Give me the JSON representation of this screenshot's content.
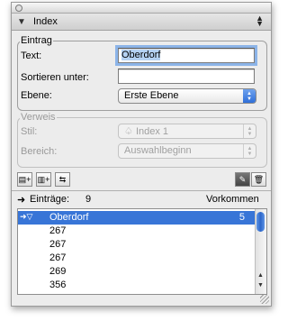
{
  "palette": {
    "title": "Index"
  },
  "entry": {
    "group_label": "Eintrag",
    "text_label": "Text:",
    "text_value": "Oberdorf",
    "sort_label": "Sortieren unter:",
    "sort_value": "",
    "level_label": "Ebene:",
    "level_value": "Erste Ebene"
  },
  "reference": {
    "group_label": "Verweis",
    "style_label": "Stil:",
    "style_value": "Index 1",
    "range_label": "Bereich:",
    "range_value": "Auswahlbeginn"
  },
  "toolbar": {
    "icons": [
      "add-entry-icon",
      "add-reference-icon",
      "find-entry-icon",
      "edit-pencil-icon",
      "trash-icon"
    ]
  },
  "list": {
    "entries_label": "Einträge:",
    "entries_count": "9",
    "occurrences_label": "Vorkommen",
    "rows": [
      {
        "text": "Oberdorf",
        "count": "5",
        "selected": true
      },
      {
        "text": "267",
        "count": ""
      },
      {
        "text": "267",
        "count": ""
      },
      {
        "text": "267",
        "count": ""
      },
      {
        "text": "269",
        "count": ""
      },
      {
        "text": "356",
        "count": ""
      }
    ]
  },
  "colors": {
    "selection": "#3875d7",
    "focus_ring": "#8cb4e8",
    "popup_accent": "#2f6fd9"
  }
}
